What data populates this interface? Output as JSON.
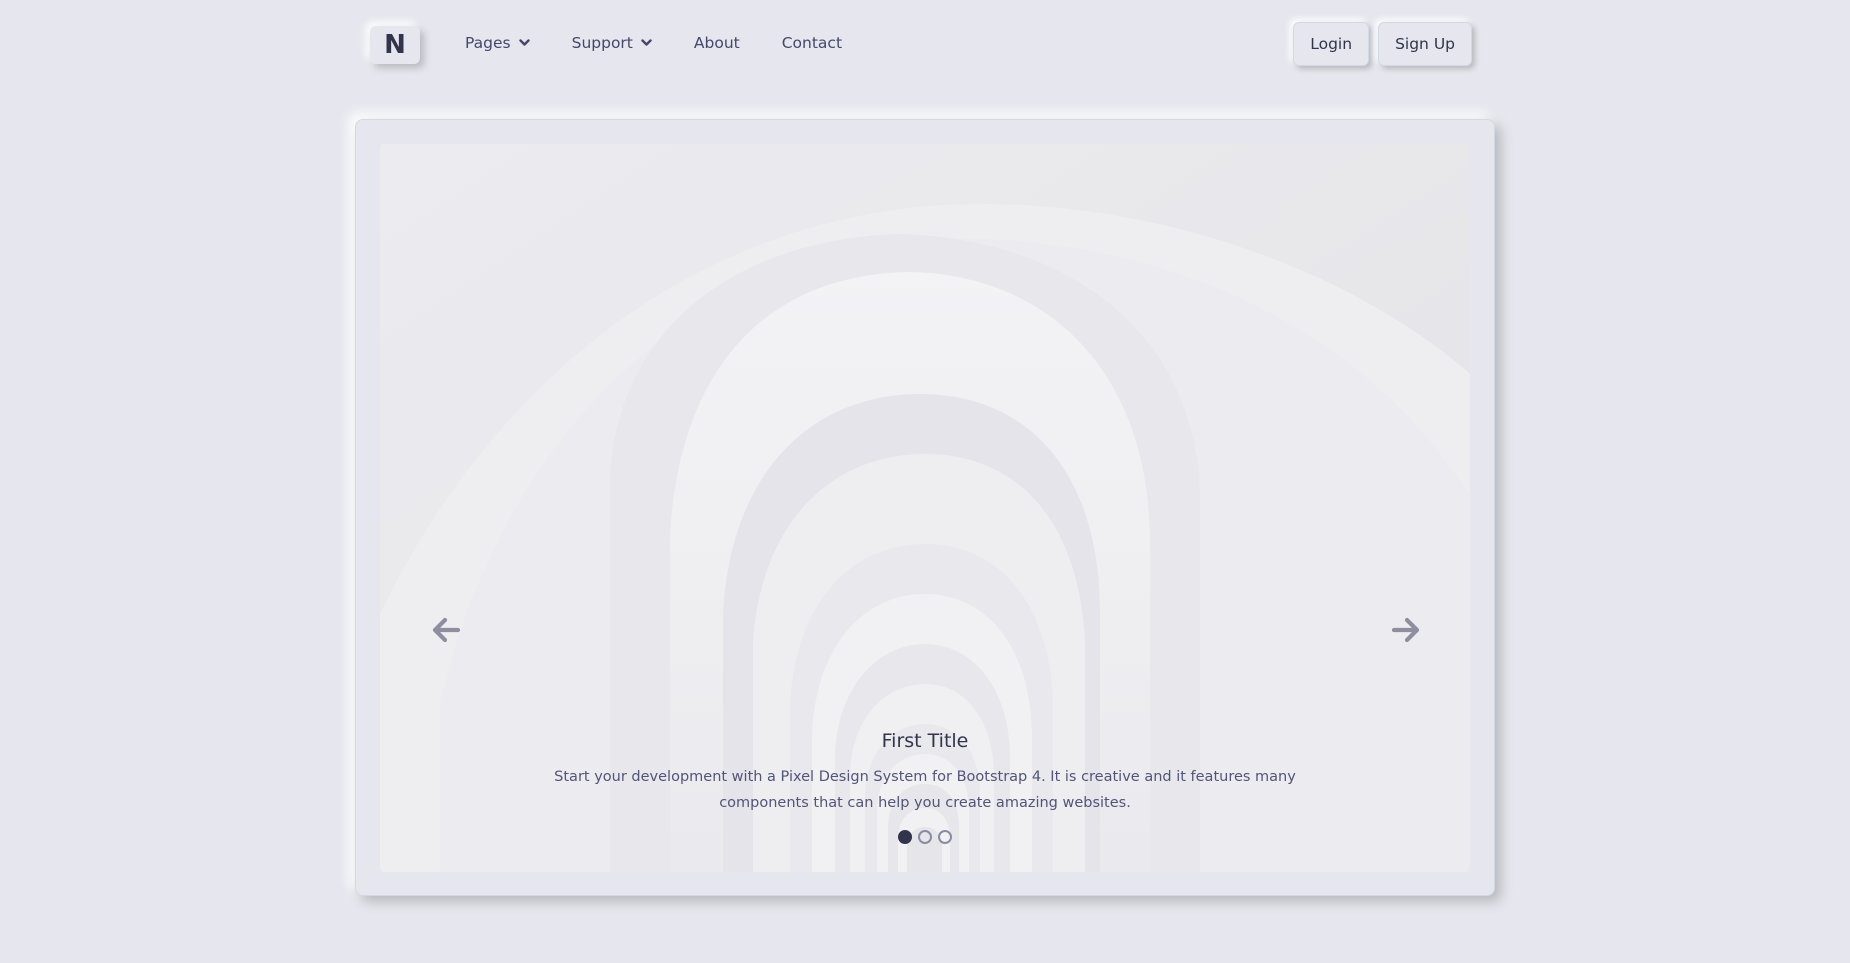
{
  "navbar": {
    "brand": "N",
    "links": [
      {
        "label": "Pages",
        "has_dropdown": true
      },
      {
        "label": "Support",
        "has_dropdown": true
      },
      {
        "label": "About",
        "has_dropdown": false
      },
      {
        "label": "Contact",
        "has_dropdown": false
      }
    ],
    "login_label": "Login",
    "signup_label": "Sign Up"
  },
  "carousel": {
    "slide_count": 3,
    "active_index": 0,
    "caption_title": "First Title",
    "caption_text": "Start your development with a Pixel Design System for Bootstrap 4. It is creative and it features many components that can help you create amazing websites.",
    "prev_icon": "arrow-left-icon",
    "next_icon": "arrow-right-icon"
  },
  "colors": {
    "background": "#e6e7ee",
    "text": "#44476a",
    "dark": "#31344b",
    "arrow": "#8e8ea0"
  }
}
